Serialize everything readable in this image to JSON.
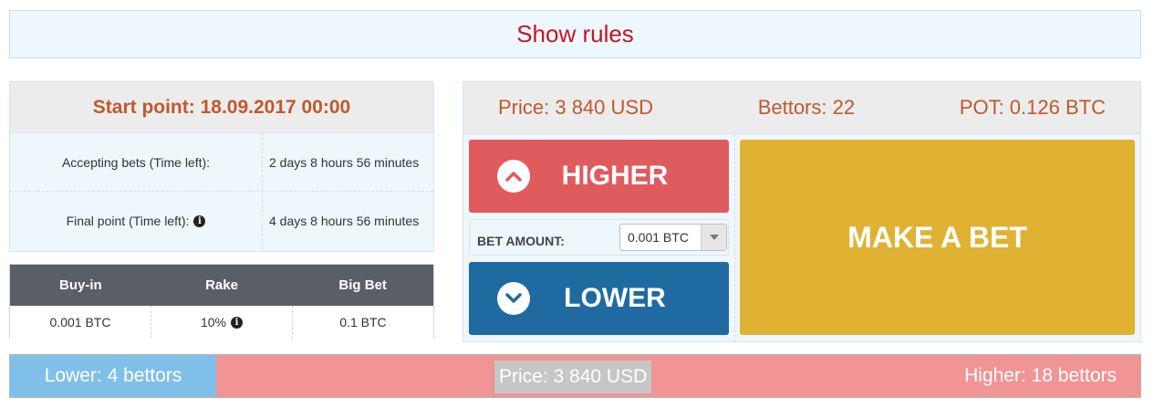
{
  "rules": {
    "label": "Show rules"
  },
  "info": {
    "start_point": "Start point: 18.09.2017 00:00",
    "rows": [
      {
        "label": "Accepting bets (Time left):",
        "value": "2 days 8 hours 56 minutes"
      },
      {
        "label": "Final point (Time left):",
        "value": "4 days 8 hours 56 minutes"
      }
    ]
  },
  "fees": {
    "headers": [
      "Buy-in",
      "Rake",
      "Big Bet"
    ],
    "values": [
      "0.001 BTC",
      "10%",
      "0.1 BTC"
    ]
  },
  "stats": {
    "price": "Price: 3 840 USD",
    "bettors": "Bettors: 22",
    "pot": "POT: 0.126 BTC"
  },
  "bet": {
    "higher_label": "HIGHER",
    "lower_label": "LOWER",
    "amount_label": "BET AMOUNT:",
    "amount_value": "0.001 BTC",
    "make_bet_label": "MAKE A BET"
  },
  "summary": {
    "lower": "Lower: 4 bettors",
    "price": "Price: 3 840 USD",
    "higher": "Higher: 18 bettors",
    "lower_count": 4,
    "higher_count": 18
  },
  "colors": {
    "higher": "#e05b5e",
    "lower": "#1f6ba1",
    "make_bet": "#e0b233",
    "accent_text": "#c0582e",
    "rules_text": "#c0172a"
  },
  "icons": {
    "info": "info-icon",
    "higher": "chevron-up-icon",
    "lower": "chevron-down-icon",
    "select": "caret-down-icon"
  }
}
